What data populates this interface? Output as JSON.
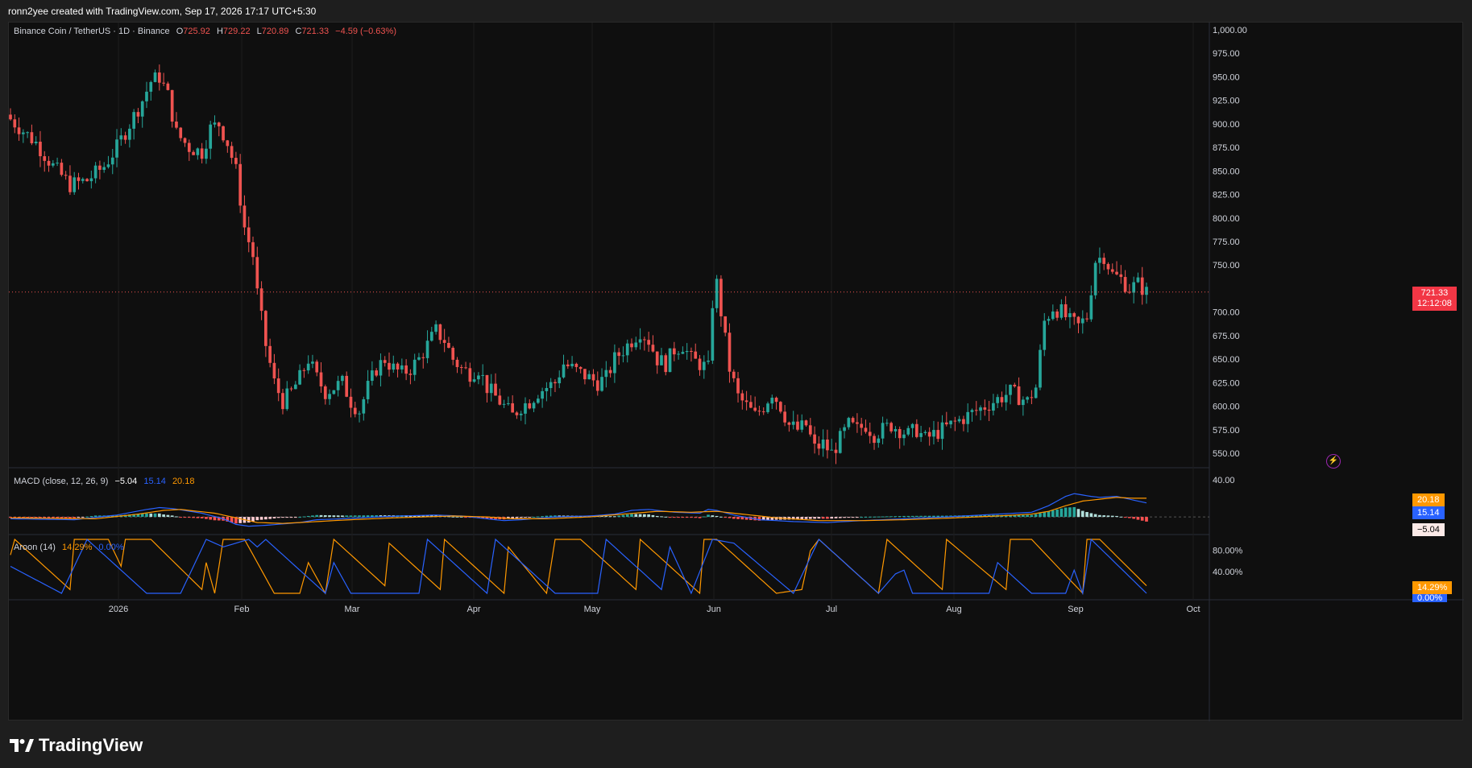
{
  "credit": "ronn2yee created with TradingView.com, Sep 17, 2026 17:17 UTC+5:30",
  "brand": "TradingView",
  "header": {
    "symbol": "Binance Coin / TetherUS · 1D · Binance",
    "o_label": "O",
    "o_value": "725.92",
    "h_label": "H",
    "h_value": "729.22",
    "l_label": "L",
    "l_value": "720.89",
    "c_label": "C",
    "c_value": "721.33",
    "change": "−4.59 (−0.63%)"
  },
  "price_tag": {
    "price": "721.33",
    "countdown": "12:12:08"
  },
  "macd": {
    "label": "MACD (close, 12, 26, 9)",
    "hist": "−5.04",
    "macd": "15.14",
    "signal": "20.18",
    "axis": [
      "40.00"
    ]
  },
  "aroon": {
    "label": "Aroon (14)",
    "up": "14.29%",
    "down": "0.00%",
    "axis": [
      "80.00%",
      "40.00%"
    ]
  },
  "colors": {
    "up": "#26a69a",
    "down": "#ef5350",
    "macd": "#2962ff",
    "signal": "#ff9800",
    "aroon_up": "#ff9800",
    "aroon_down": "#2962ff"
  },
  "chart_data": {
    "type": "candlestick",
    "title": "Binance Coin / TetherUS · 1D · Binance",
    "y_ticks": [
      "1,000.00",
      "975.00",
      "950.00",
      "925.00",
      "900.00",
      "875.00",
      "850.00",
      "825.00",
      "800.00",
      "775.00",
      "750.00",
      "700.00",
      "675.00",
      "650.00",
      "625.00",
      "600.00",
      "575.00",
      "550.00"
    ],
    "ylim": [
      543,
      1000
    ],
    "x_ticks": [
      "2026",
      "Feb",
      "Mar",
      "Apr",
      "May",
      "Jun",
      "Jul",
      "Aug",
      "Sep",
      "Oct"
    ],
    "anchors": [
      [
        0,
        905
      ],
      [
        6,
        880
      ],
      [
        10,
        855
      ],
      [
        14,
        835
      ],
      [
        18,
        840
      ],
      [
        22,
        855
      ],
      [
        25,
        875
      ],
      [
        28,
        900
      ],
      [
        31,
        925
      ],
      [
        33,
        945
      ],
      [
        35,
        950
      ],
      [
        37,
        930
      ],
      [
        39,
        890
      ],
      [
        42,
        875
      ],
      [
        45,
        870
      ],
      [
        47,
        895
      ],
      [
        49,
        900
      ],
      [
        51,
        880
      ],
      [
        53,
        850
      ],
      [
        55,
        790
      ],
      [
        57,
        760
      ],
      [
        58,
        720
      ],
      [
        60,
        665
      ],
      [
        62,
        625
      ],
      [
        64,
        605
      ],
      [
        66,
        615
      ],
      [
        68,
        630
      ],
      [
        70,
        650
      ],
      [
        72,
        630
      ],
      [
        74,
        615
      ],
      [
        76,
        620
      ],
      [
        78,
        625
      ],
      [
        80,
        605
      ],
      [
        82,
        595
      ],
      [
        84,
        620
      ],
      [
        86,
        640
      ],
      [
        88,
        650
      ],
      [
        90,
        640
      ],
      [
        92,
        635
      ],
      [
        94,
        640
      ],
      [
        96,
        650
      ],
      [
        98,
        665
      ],
      [
        100,
        680
      ],
      [
        102,
        670
      ],
      [
        104,
        650
      ],
      [
        106,
        640
      ],
      [
        108,
        635
      ],
      [
        110,
        640
      ],
      [
        112,
        620
      ],
      [
        114,
        610
      ],
      [
        116,
        600
      ],
      [
        118,
        590
      ],
      [
        120,
        600
      ],
      [
        122,
        605
      ],
      [
        124,
        615
      ],
      [
        126,
        620
      ],
      [
        128,
        625
      ],
      [
        130,
        645
      ],
      [
        132,
        640
      ],
      [
        134,
        635
      ],
      [
        136,
        630
      ],
      [
        138,
        625
      ],
      [
        140,
        630
      ],
      [
        142,
        650
      ],
      [
        144,
        660
      ],
      [
        146,
        670
      ],
      [
        148,
        680
      ],
      [
        150,
        670
      ],
      [
        152,
        650
      ],
      [
        154,
        645
      ],
      [
        156,
        660
      ],
      [
        158,
        665
      ],
      [
        160,
        650
      ],
      [
        162,
        645
      ],
      [
        164,
        640
      ],
      [
        165,
        710
      ],
      [
        166,
        730
      ],
      [
        167,
        700
      ],
      [
        169,
        640
      ],
      [
        171,
        610
      ],
      [
        173,
        600
      ],
      [
        175,
        590
      ],
      [
        177,
        600
      ],
      [
        179,
        615
      ],
      [
        181,
        600
      ],
      [
        183,
        580
      ],
      [
        185,
        575
      ],
      [
        187,
        580
      ],
      [
        189,
        555
      ],
      [
        191,
        560
      ],
      [
        193,
        550
      ],
      [
        195,
        565
      ],
      [
        197,
        580
      ],
      [
        199,
        575
      ],
      [
        201,
        580
      ],
      [
        203,
        570
      ],
      [
        205,
        575
      ],
      [
        207,
        580
      ],
      [
        209,
        575
      ],
      [
        211,
        570
      ],
      [
        213,
        575
      ],
      [
        215,
        565
      ],
      [
        217,
        570
      ],
      [
        219,
        575
      ],
      [
        221,
        580
      ],
      [
        223,
        585
      ],
      [
        225,
        590
      ],
      [
        227,
        595
      ],
      [
        229,
        600
      ],
      [
        231,
        605
      ],
      [
        233,
        610
      ],
      [
        235,
        615
      ],
      [
        237,
        610
      ],
      [
        239,
        605
      ],
      [
        241,
        620
      ],
      [
        243,
        690
      ],
      [
        245,
        705
      ],
      [
        247,
        700
      ],
      [
        249,
        690
      ],
      [
        251,
        685
      ],
      [
        253,
        695
      ],
      [
        255,
        755
      ],
      [
        257,
        760
      ],
      [
        259,
        740
      ],
      [
        261,
        735
      ],
      [
        263,
        725
      ],
      [
        265,
        730
      ],
      [
        267,
        721
      ]
    ],
    "n_days": 268,
    "macd_anchors": [
      [
        0,
        -2
      ],
      [
        15,
        -3
      ],
      [
        25,
        2
      ],
      [
        32,
        8
      ],
      [
        35,
        10
      ],
      [
        38,
        9
      ],
      [
        45,
        4
      ],
      [
        50,
        -2
      ],
      [
        53,
        -8
      ],
      [
        56,
        -10
      ],
      [
        60,
        -9
      ],
      [
        68,
        -6
      ],
      [
        72,
        -3
      ],
      [
        78,
        -2
      ],
      [
        86,
        0
      ],
      [
        92,
        1
      ],
      [
        100,
        2
      ],
      [
        106,
        1
      ],
      [
        112,
        -2
      ],
      [
        116,
        -4
      ],
      [
        120,
        -3
      ],
      [
        128,
        0
      ],
      [
        136,
        1
      ],
      [
        142,
        3
      ],
      [
        146,
        7
      ],
      [
        150,
        8
      ],
      [
        156,
        5
      ],
      [
        162,
        4
      ],
      [
        164,
        8
      ],
      [
        166,
        7
      ],
      [
        170,
        2
      ],
      [
        176,
        -3
      ],
      [
        184,
        -5
      ],
      [
        192,
        -6
      ],
      [
        200,
        -4
      ],
      [
        210,
        -2
      ],
      [
        220,
        0
      ],
      [
        228,
        2
      ],
      [
        236,
        4
      ],
      [
        240,
        5
      ],
      [
        244,
        12
      ],
      [
        248,
        22
      ],
      [
        250,
        25
      ],
      [
        254,
        22
      ],
      [
        256,
        21
      ],
      [
        260,
        22
      ],
      [
        264,
        18
      ],
      [
        267,
        15
      ]
    ],
    "signal_anchors": [
      [
        0,
        -1
      ],
      [
        20,
        -2
      ],
      [
        30,
        3
      ],
      [
        36,
        7
      ],
      [
        40,
        8
      ],
      [
        48,
        4
      ],
      [
        54,
        -2
      ],
      [
        58,
        -6
      ],
      [
        64,
        -7
      ],
      [
        72,
        -5
      ],
      [
        80,
        -3
      ],
      [
        90,
        -1
      ],
      [
        104,
        1
      ],
      [
        112,
        0
      ],
      [
        118,
        -2
      ],
      [
        126,
        -2
      ],
      [
        136,
        0
      ],
      [
        144,
        3
      ],
      [
        152,
        6
      ],
      [
        160,
        5
      ],
      [
        166,
        6
      ],
      [
        172,
        3
      ],
      [
        180,
        -1
      ],
      [
        190,
        -4
      ],
      [
        200,
        -4
      ],
      [
        210,
        -3
      ],
      [
        222,
        -1
      ],
      [
        232,
        1
      ],
      [
        240,
        3
      ],
      [
        244,
        6
      ],
      [
        248,
        12
      ],
      [
        252,
        17
      ],
      [
        256,
        19
      ],
      [
        260,
        21
      ],
      [
        264,
        20
      ],
      [
        267,
        20
      ]
    ],
    "aroon_up_anchors": [
      [
        0,
        71
      ],
      [
        1,
        100
      ],
      [
        14,
        7
      ],
      [
        15,
        100
      ],
      [
        23,
        100
      ],
      [
        26,
        50
      ],
      [
        27,
        100
      ],
      [
        33,
        100
      ],
      [
        45,
        7
      ],
      [
        46,
        57
      ],
      [
        48,
        0
      ],
      [
        50,
        100
      ],
      [
        55,
        100
      ],
      [
        62,
        0
      ],
      [
        68,
        0
      ],
      [
        70,
        57
      ],
      [
        74,
        0
      ],
      [
        76,
        100
      ],
      [
        88,
        14
      ],
      [
        89,
        93
      ],
      [
        101,
        7
      ],
      [
        102,
        100
      ],
      [
        116,
        0
      ],
      [
        117,
        86
      ],
      [
        126,
        0
      ],
      [
        128,
        100
      ],
      [
        134,
        100
      ],
      [
        147,
        7
      ],
      [
        148,
        100
      ],
      [
        162,
        0
      ],
      [
        163,
        100
      ],
      [
        166,
        100
      ],
      [
        180,
        0
      ],
      [
        186,
        7
      ],
      [
        188,
        79
      ],
      [
        190,
        100
      ],
      [
        204,
        0
      ],
      [
        206,
        100
      ],
      [
        219,
        7
      ],
      [
        220,
        100
      ],
      [
        234,
        7
      ],
      [
        235,
        100
      ],
      [
        240,
        100
      ],
      [
        252,
        0
      ],
      [
        253,
        100
      ],
      [
        256,
        100
      ],
      [
        267,
        14
      ]
    ],
    "aroon_down_anchors": [
      [
        0,
        50
      ],
      [
        12,
        0
      ],
      [
        18,
        100
      ],
      [
        32,
        0
      ],
      [
        40,
        0
      ],
      [
        46,
        100
      ],
      [
        50,
        86
      ],
      [
        56,
        100
      ],
      [
        58,
        86
      ],
      [
        60,
        100
      ],
      [
        74,
        0
      ],
      [
        76,
        57
      ],
      [
        80,
        0
      ],
      [
        96,
        0
      ],
      [
        98,
        100
      ],
      [
        112,
        0
      ],
      [
        114,
        100
      ],
      [
        128,
        0
      ],
      [
        138,
        0
      ],
      [
        140,
        100
      ],
      [
        153,
        7
      ],
      [
        155,
        86
      ],
      [
        160,
        0
      ],
      [
        165,
        100
      ],
      [
        170,
        93
      ],
      [
        184,
        0
      ],
      [
        190,
        100
      ],
      [
        204,
        0
      ],
      [
        208,
        36
      ],
      [
        210,
        43
      ],
      [
        212,
        0
      ],
      [
        230,
        0
      ],
      [
        232,
        57
      ],
      [
        240,
        0
      ],
      [
        248,
        0
      ],
      [
        250,
        43
      ],
      [
        252,
        0
      ],
      [
        254,
        100
      ],
      [
        267,
        0
      ]
    ]
  }
}
